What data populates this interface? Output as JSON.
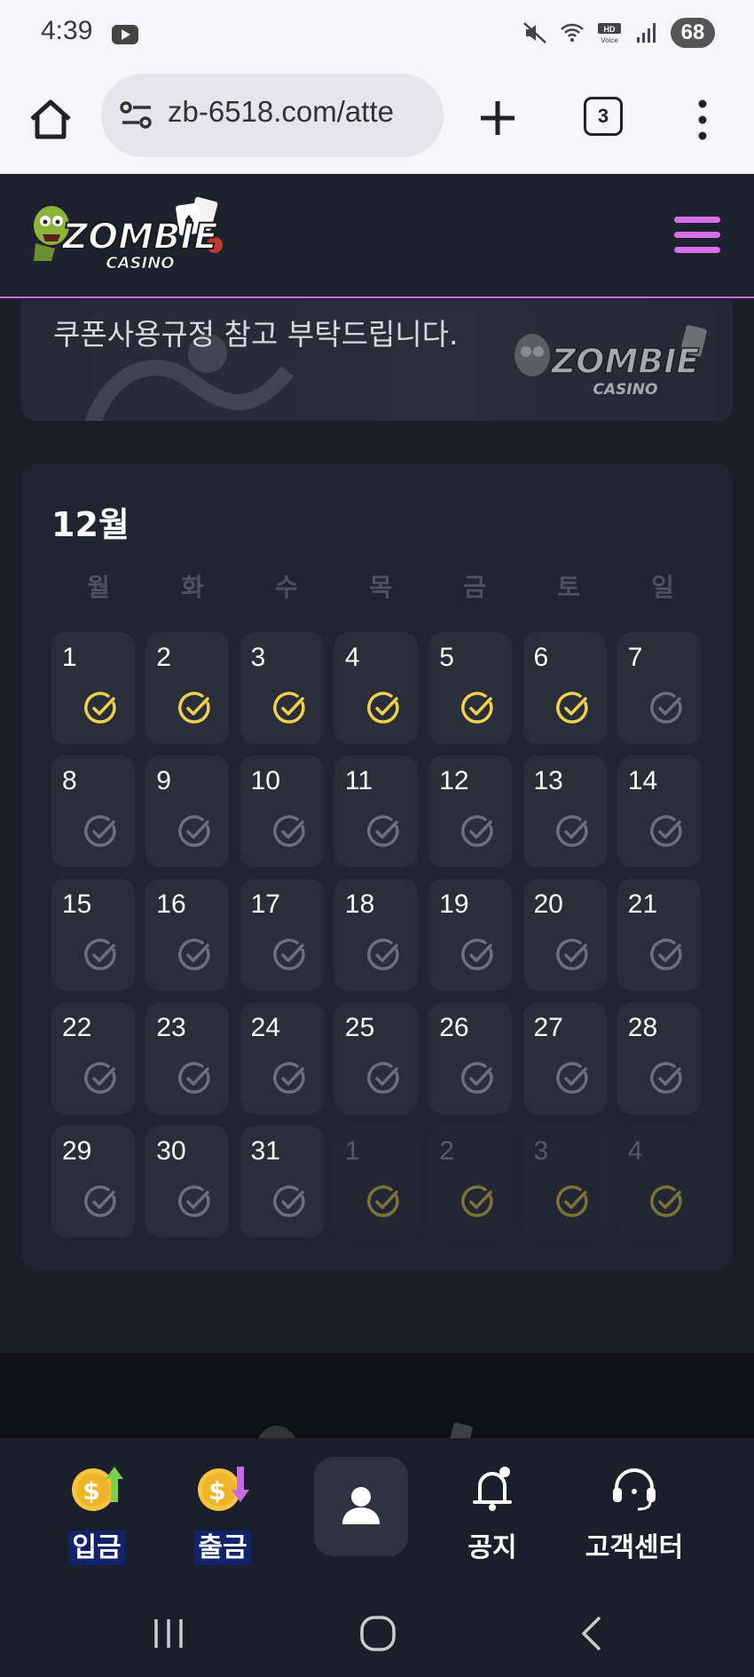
{
  "status_bar": {
    "time": "4:39",
    "battery": "68",
    "icons": [
      "youtube-icon",
      "mute-icon",
      "wifi-icon",
      "hd-voice-icon",
      "signal-icon"
    ]
  },
  "browser": {
    "url": "zb-6518.com/atte",
    "tab_count": "3"
  },
  "site": {
    "brand": "ZOMBIE CASINO",
    "accent_color": "#d66fe8"
  },
  "banner": {
    "text": "쿠폰사용규정 참고 부탁드립니다."
  },
  "calendar": {
    "month_label": "12월",
    "weekdays": [
      "월",
      "화",
      "수",
      "목",
      "금",
      "토",
      "일"
    ],
    "days": [
      {
        "num": "1",
        "checked": true,
        "current": true
      },
      {
        "num": "2",
        "checked": true,
        "current": true
      },
      {
        "num": "3",
        "checked": true,
        "current": true
      },
      {
        "num": "4",
        "checked": true,
        "current": true
      },
      {
        "num": "5",
        "checked": true,
        "current": true
      },
      {
        "num": "6",
        "checked": true,
        "current": true
      },
      {
        "num": "7",
        "checked": false,
        "current": true
      },
      {
        "num": "8",
        "checked": false,
        "current": true
      },
      {
        "num": "9",
        "checked": false,
        "current": true
      },
      {
        "num": "10",
        "checked": false,
        "current": true
      },
      {
        "num": "11",
        "checked": false,
        "current": true
      },
      {
        "num": "12",
        "checked": false,
        "current": true
      },
      {
        "num": "13",
        "checked": false,
        "current": true
      },
      {
        "num": "14",
        "checked": false,
        "current": true
      },
      {
        "num": "15",
        "checked": false,
        "current": true
      },
      {
        "num": "16",
        "checked": false,
        "current": true
      },
      {
        "num": "17",
        "checked": false,
        "current": true
      },
      {
        "num": "18",
        "checked": false,
        "current": true
      },
      {
        "num": "19",
        "checked": false,
        "current": true
      },
      {
        "num": "20",
        "checked": false,
        "current": true
      },
      {
        "num": "21",
        "checked": false,
        "current": true
      },
      {
        "num": "22",
        "checked": false,
        "current": true
      },
      {
        "num": "23",
        "checked": false,
        "current": true
      },
      {
        "num": "24",
        "checked": false,
        "current": true
      },
      {
        "num": "25",
        "checked": false,
        "current": true
      },
      {
        "num": "26",
        "checked": false,
        "current": true
      },
      {
        "num": "27",
        "checked": false,
        "current": true
      },
      {
        "num": "28",
        "checked": false,
        "current": true
      },
      {
        "num": "29",
        "checked": false,
        "current": true
      },
      {
        "num": "30",
        "checked": false,
        "current": true
      },
      {
        "num": "31",
        "checked": false,
        "current": true
      },
      {
        "num": "1",
        "checked": true,
        "current": false
      },
      {
        "num": "2",
        "checked": true,
        "current": false
      },
      {
        "num": "3",
        "checked": true,
        "current": false
      },
      {
        "num": "4",
        "checked": true,
        "current": false
      }
    ],
    "checked_color": "#f2d14a",
    "unchecked_color": "#6b707c",
    "other_month_checked_color": "#7d7338"
  },
  "bottom_nav": {
    "deposit_label": "입금",
    "withdraw_label": "출금",
    "notice_label": "공지",
    "support_label": "고객센터"
  }
}
